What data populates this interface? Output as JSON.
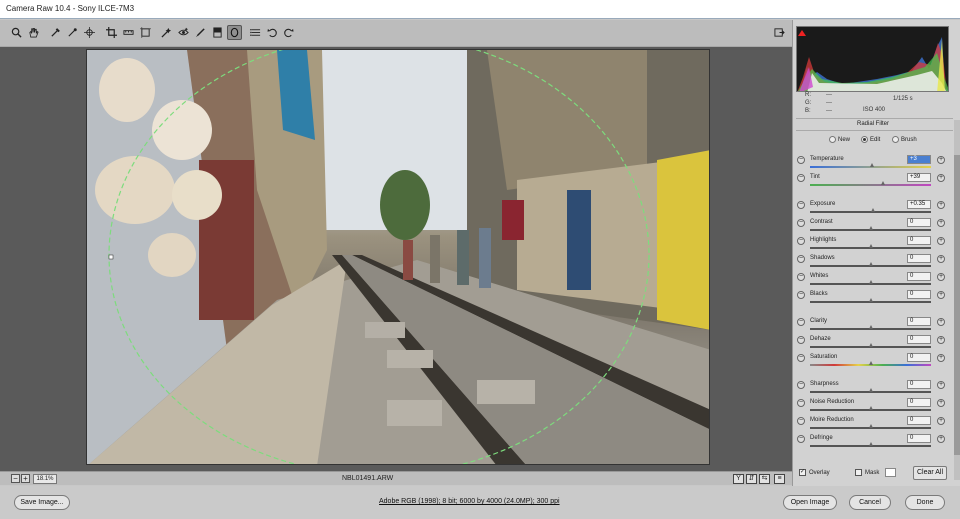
{
  "window": {
    "title": "Camera Raw 10.4  -  Sony ILCE-7M3"
  },
  "toolbar": {
    "tools": [
      {
        "name": "zoom-tool",
        "glyph": "🔍"
      },
      {
        "name": "hand-tool",
        "glyph": "✋"
      },
      {
        "name": "white-balance-tool",
        "glyph": "✎"
      },
      {
        "name": "color-sampler-tool",
        "glyph": "✢"
      },
      {
        "name": "targeted-adjustment-tool",
        "glyph": "◎"
      },
      {
        "name": "crop-tool",
        "glyph": "⌗"
      },
      {
        "name": "straighten-tool",
        "glyph": "▭"
      },
      {
        "name": "transform-tool",
        "glyph": "⊞"
      },
      {
        "name": "spot-removal-tool",
        "glyph": "✐"
      },
      {
        "name": "red-eye-tool",
        "glyph": "👁"
      },
      {
        "name": "adjustment-brush-tool",
        "glyph": "✏"
      },
      {
        "name": "graduated-filter-tool",
        "glyph": "▮"
      },
      {
        "name": "radial-filter-tool",
        "glyph": "◯"
      },
      {
        "name": "preferences",
        "glyph": "☰"
      },
      {
        "name": "rotate-left",
        "glyph": "↺"
      },
      {
        "name": "rotate-right",
        "glyph": "↻"
      }
    ],
    "fullscreen_glyph": "⇱"
  },
  "image": {
    "filename": "NBL01491.ARW",
    "zoom": "18.1%",
    "zoom_minus": "−",
    "zoom_plus": "+"
  },
  "view_buttons": [
    "Y",
    "⇵",
    "⇆",
    "≡"
  ],
  "histogram": {
    "r_label": "R:",
    "r_val": "---",
    "g_label": "G:",
    "g_val": "---",
    "b_label": "B:",
    "b_val": "---",
    "shutter": "1/125 s",
    "iso": "ISO 400"
  },
  "panel": {
    "title": "Radial Filter",
    "modes": [
      {
        "label": "New",
        "selected": false
      },
      {
        "label": "Edit",
        "selected": true
      },
      {
        "label": "Brush",
        "selected": false
      }
    ],
    "sliders": [
      {
        "label": "Temperature",
        "value": "+3",
        "selected": true,
        "position": 0.51
      },
      {
        "label": "Tint",
        "value": "+39",
        "selected": false,
        "position": 0.6
      },
      {
        "label": "Exposure",
        "value": "+0.35",
        "selected": false,
        "position": 0.52
      },
      {
        "label": "Contrast",
        "value": "0",
        "selected": false,
        "position": 0.5
      },
      {
        "label": "Highlights",
        "value": "0",
        "selected": false,
        "position": 0.5
      },
      {
        "label": "Shadows",
        "value": "0",
        "selected": false,
        "position": 0.5
      },
      {
        "label": "Whites",
        "value": "0",
        "selected": false,
        "position": 0.5
      },
      {
        "label": "Blacks",
        "value": "0",
        "selected": false,
        "position": 0.5
      },
      {
        "label": "Clarity",
        "value": "0",
        "selected": false,
        "position": 0.5
      },
      {
        "label": "Dehaze",
        "value": "0",
        "selected": false,
        "position": 0.5
      },
      {
        "label": "Saturation",
        "value": "0",
        "selected": false,
        "position": 0.5
      },
      {
        "label": "Sharpness",
        "value": "0",
        "selected": false,
        "position": 0.5
      },
      {
        "label": "Noise Reduction",
        "value": "0",
        "selected": false,
        "position": 0.5
      },
      {
        "label": "Moire Reduction",
        "value": "0",
        "selected": false,
        "position": 0.5
      },
      {
        "label": "Defringe",
        "value": "0",
        "selected": false,
        "position": 0.5
      }
    ],
    "overlay": {
      "label": "Overlay",
      "checked": true
    },
    "mask": {
      "label": "Mask",
      "checked": false
    },
    "clear_all": "Clear All"
  },
  "bottom": {
    "save_image": "Save Image...",
    "workflow": "Adobe RGB (1998); 8 bit; 6000 by 4000 (24.0MP); 300 ppi",
    "open_image": "Open Image",
    "cancel": "Cancel",
    "done": "Done"
  }
}
